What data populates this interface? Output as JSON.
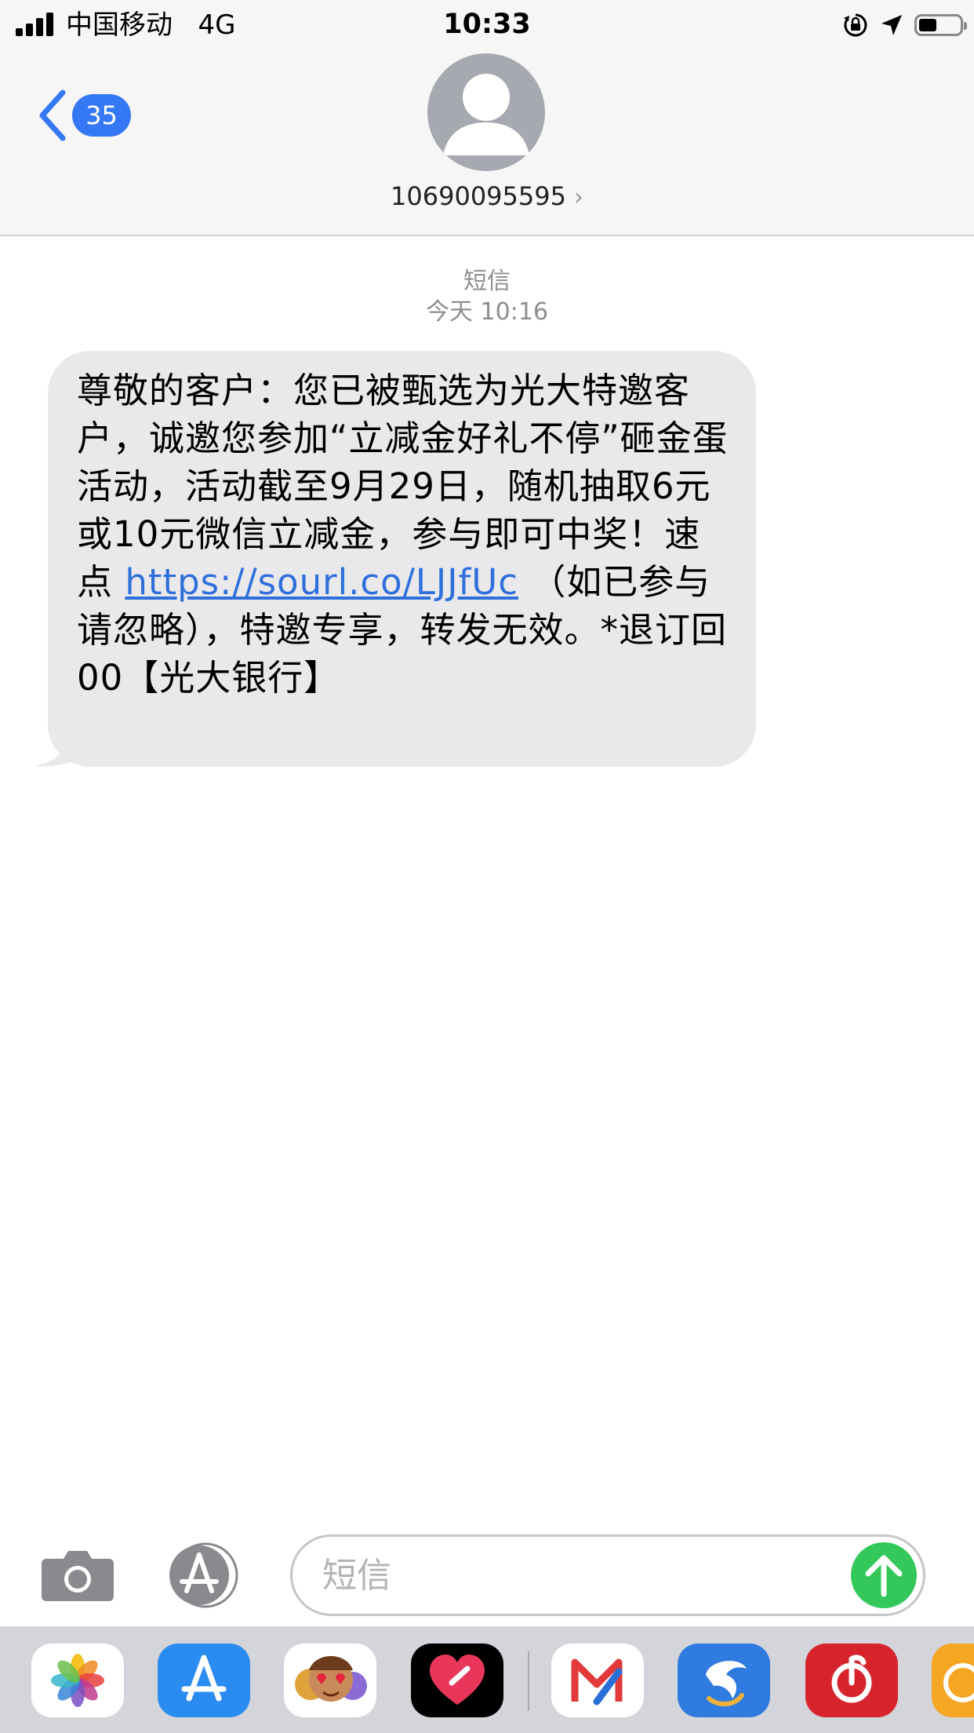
{
  "status_bar": {
    "carrier": "中国移动",
    "network": "4G",
    "time": "10:33"
  },
  "header": {
    "back_badge": "35",
    "contact_number": "10690095595",
    "chevron": "›"
  },
  "thread": {
    "service_label": "短信",
    "timestamp": "今天 10:16",
    "message": {
      "text_before_link": "尊敬的客户：您已被甄选为光大特邀客户，诚邀您参加“立减金好礼不停”砸金蛋活动，活动截至9月29日，随机抽取6元或10元微信立减金，参与即可中奖！速点 ",
      "link": "https://sourl.co/LJJfUc",
      "text_after_link": " （如已参与请忽略），特邀专享，转发无效。*退订回00【光大银行】"
    }
  },
  "composer": {
    "placeholder": "短信"
  },
  "app_drawer": {
    "apps": [
      "photos-icon",
      "app-store-icon",
      "memoji-icon",
      "digital-touch-icon",
      "mail-app-icon",
      "feizhu-icon",
      "netease-music-icon",
      "orange-app-icon"
    ]
  },
  "colors": {
    "accent": "#3478f6",
    "bubble": "#e9e9eb",
    "send": "#34c759",
    "link": "#2f6fdc"
  }
}
